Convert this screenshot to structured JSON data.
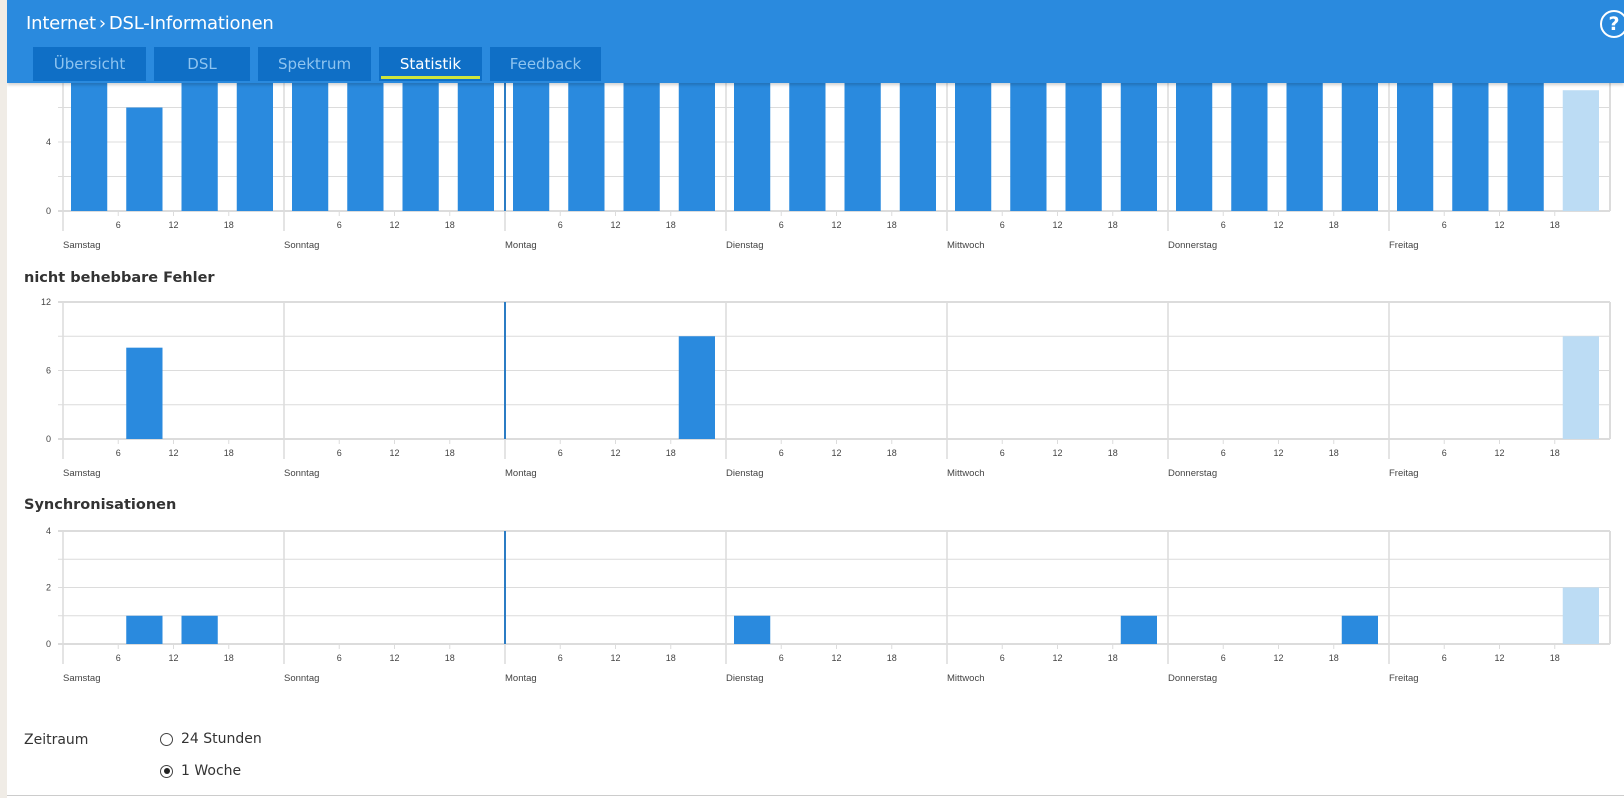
{
  "header": {
    "breadcrumb": [
      "Internet",
      "DSL-Informationen"
    ],
    "breadcrumb_separator": "›",
    "help_label": "?"
  },
  "tabs": [
    {
      "label": "Übersicht",
      "active": false
    },
    {
      "label": "DSL",
      "active": false
    },
    {
      "label": "Spektrum",
      "active": false
    },
    {
      "label": "Statistik",
      "active": true
    },
    {
      "label": "Feedback",
      "active": false
    }
  ],
  "colors": {
    "header": "#2a8ade",
    "tab": "#0f6fc6",
    "tab_active_underline": "#cde53b",
    "bar": "#2a8ade",
    "bar_current": "#bcdcf4",
    "grid": "#dcdcdc"
  },
  "zeitraum": {
    "label": "Zeitraum",
    "options": [
      {
        "label": "24 Stunden",
        "checked": false
      },
      {
        "label": "1 Woche",
        "checked": true
      }
    ]
  },
  "chart_data": [
    {
      "type": "bar",
      "title": "",
      "note": "upper part of chart scrolled out of view; full-height bars are clipped at the visible top",
      "days": [
        "Samstag",
        "Sonntag",
        "Montag",
        "Dienstag",
        "Mittwoch",
        "Donnerstag",
        "Freitag"
      ],
      "hour_ticks": [
        6,
        12,
        18
      ],
      "buckets_per_day": 4,
      "yticks": [
        0,
        4
      ],
      "ylim": [
        0,
        8
      ],
      "values": [
        8,
        6,
        8,
        8,
        8,
        8,
        8,
        8,
        8,
        8,
        8,
        8,
        8,
        8,
        8,
        8,
        8,
        8,
        8,
        8,
        8,
        8,
        8,
        8,
        8,
        8,
        8,
        7
      ],
      "current_bucket_index": 27,
      "marker_day_index": 2
    },
    {
      "type": "bar",
      "title": "nicht behebbare Fehler",
      "days": [
        "Samstag",
        "Sonntag",
        "Montag",
        "Dienstag",
        "Mittwoch",
        "Donnerstag",
        "Freitag"
      ],
      "hour_ticks": [
        6,
        12,
        18
      ],
      "buckets_per_day": 4,
      "yticks": [
        0,
        6,
        12
      ],
      "ylim": [
        0,
        12
      ],
      "values": [
        0,
        8,
        0,
        0,
        0,
        0,
        0,
        0,
        0,
        0,
        0,
        9,
        0,
        0,
        0,
        0,
        0,
        0,
        0,
        0,
        0,
        0,
        0,
        0,
        0,
        0,
        0,
        9
      ],
      "current_bucket_index": 27,
      "marker_day_index": 2
    },
    {
      "type": "bar",
      "title": "Synchronisationen",
      "days": [
        "Samstag",
        "Sonntag",
        "Montag",
        "Dienstag",
        "Mittwoch",
        "Donnerstag",
        "Freitag"
      ],
      "hour_ticks": [
        6,
        12,
        18
      ],
      "buckets_per_day": 4,
      "yticks": [
        0,
        2,
        4
      ],
      "ylim": [
        0,
        4
      ],
      "values": [
        0,
        1,
        1,
        0,
        0,
        0,
        0,
        0,
        0,
        0,
        0,
        0,
        1,
        0,
        0,
        0,
        0,
        0,
        0,
        1,
        0,
        0,
        0,
        1,
        0,
        0,
        0,
        2
      ],
      "current_bucket_index": 27,
      "marker_day_index": 2
    }
  ]
}
